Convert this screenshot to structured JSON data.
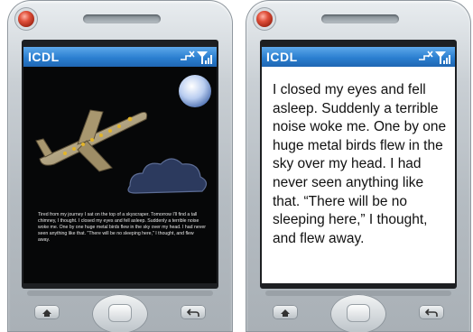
{
  "devices": [
    {
      "app_title": "ICDL",
      "story_text": "Tired from my journey I sat on the top of a skyscraper. Tomorrow I'll find a tall chimney, I thought. I closed my eyes and fell asleep. Suddenly a terrible noise woke me. One by one huge metal birds flew in the sky over my head. I had never seen anything like that. \"There will be no sleeping here,\" I thought, and flew away."
    },
    {
      "app_title": "ICDL",
      "story_text": "I closed my eyes and fell asleep. Suddenly a terrible noise woke me. One by one huge metal birds flew in the sky over my head. I had never seen anything like that. “There will be no sleeping here,” I thought, and flew away."
    }
  ],
  "icons": [
    "signal-icon",
    "no-sync-icon",
    "home-icon",
    "back-icon"
  ],
  "colors": {
    "titlebar": "#2b7fd0",
    "night_sky": "#060708",
    "moon": "#cfe0ff",
    "plane": "#b7a27a"
  }
}
